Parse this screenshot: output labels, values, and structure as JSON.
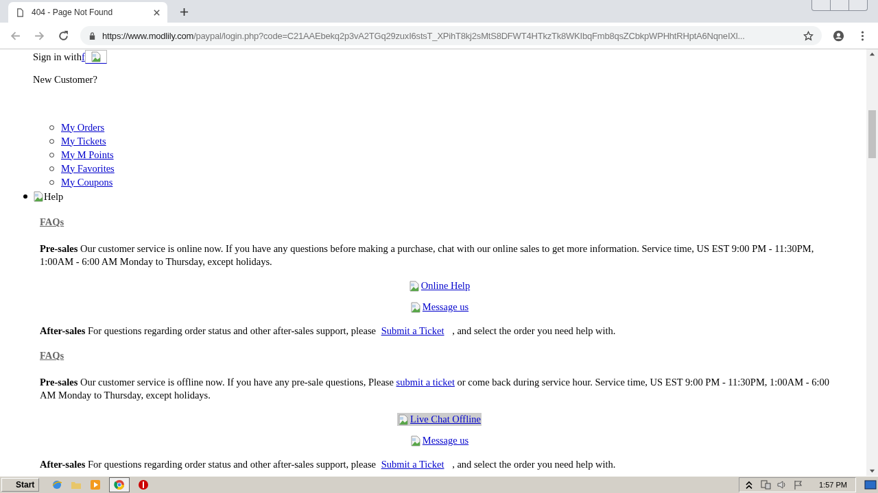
{
  "browser": {
    "tab": {
      "title": "404 - Page Not Found"
    },
    "url": {
      "host": "https://www.modlily.com",
      "path": "/paypal/login.php?code=C21AAEbekq2p3vA2TGq29zuxI6stsT_XPihT8kj2sMtS8DFWT4HTkzTk8WKIbqFmb8qsZCbkpWPHhtRHptA6NqneIXl..."
    }
  },
  "page": {
    "sign_in": {
      "label": "Sign in with",
      "link": "f"
    },
    "new_customer": "New Customer?",
    "account_links": [
      "My Orders",
      "My Tickets",
      "My M Points",
      "My Favorites",
      "My Coupons"
    ],
    "help": {
      "label": "Help"
    },
    "sections": [
      {
        "heading": "FAQs",
        "pre_sales": {
          "text": "**Pre-sales** Our customer service is online now. If you have any questions before making a purchase, chat with our online sales to get more information. Service time, US EST 9:00 PM - 11:30PM, 1:00AM - 6:00 AM Monday to Thursday, except holidays."
        },
        "help_links": [
          {
            "text": " Online Help",
            "highlighted": false
          },
          {
            "text": " Message us",
            "highlighted": false
          }
        ],
        "after_sales": {
          "before": "**After-sales** For questions regarding order status and other after-sales support, please ",
          "link": "Submit a Ticket",
          "after": " , and select the order you need help with."
        }
      },
      {
        "heading": "FAQs",
        "pre_sales": {
          "text": "**Pre-sales** Our customer service is offline now. If you have any pre-sale questions, Please ",
          "link": "submit a ticket",
          "after": " or come back during service hour. Service time, US EST 9:00 PM - 11:30PM, 1:00AM - 6:00 AM Monday to Thursday, except holidays."
        },
        "help_links": [
          {
            "text": " Live Chat Offline",
            "highlighted": true
          },
          {
            "text": " Message us",
            "highlighted": false
          }
        ],
        "after_sales": {
          "before": "**After-sales** For questions regarding order status and other after-sales support, please ",
          "link": "Submit a Ticket",
          "after": " , and select the order you need help with."
        }
      }
    ]
  },
  "taskbar": {
    "start": "Start",
    "clock": "1:57 PM"
  }
}
